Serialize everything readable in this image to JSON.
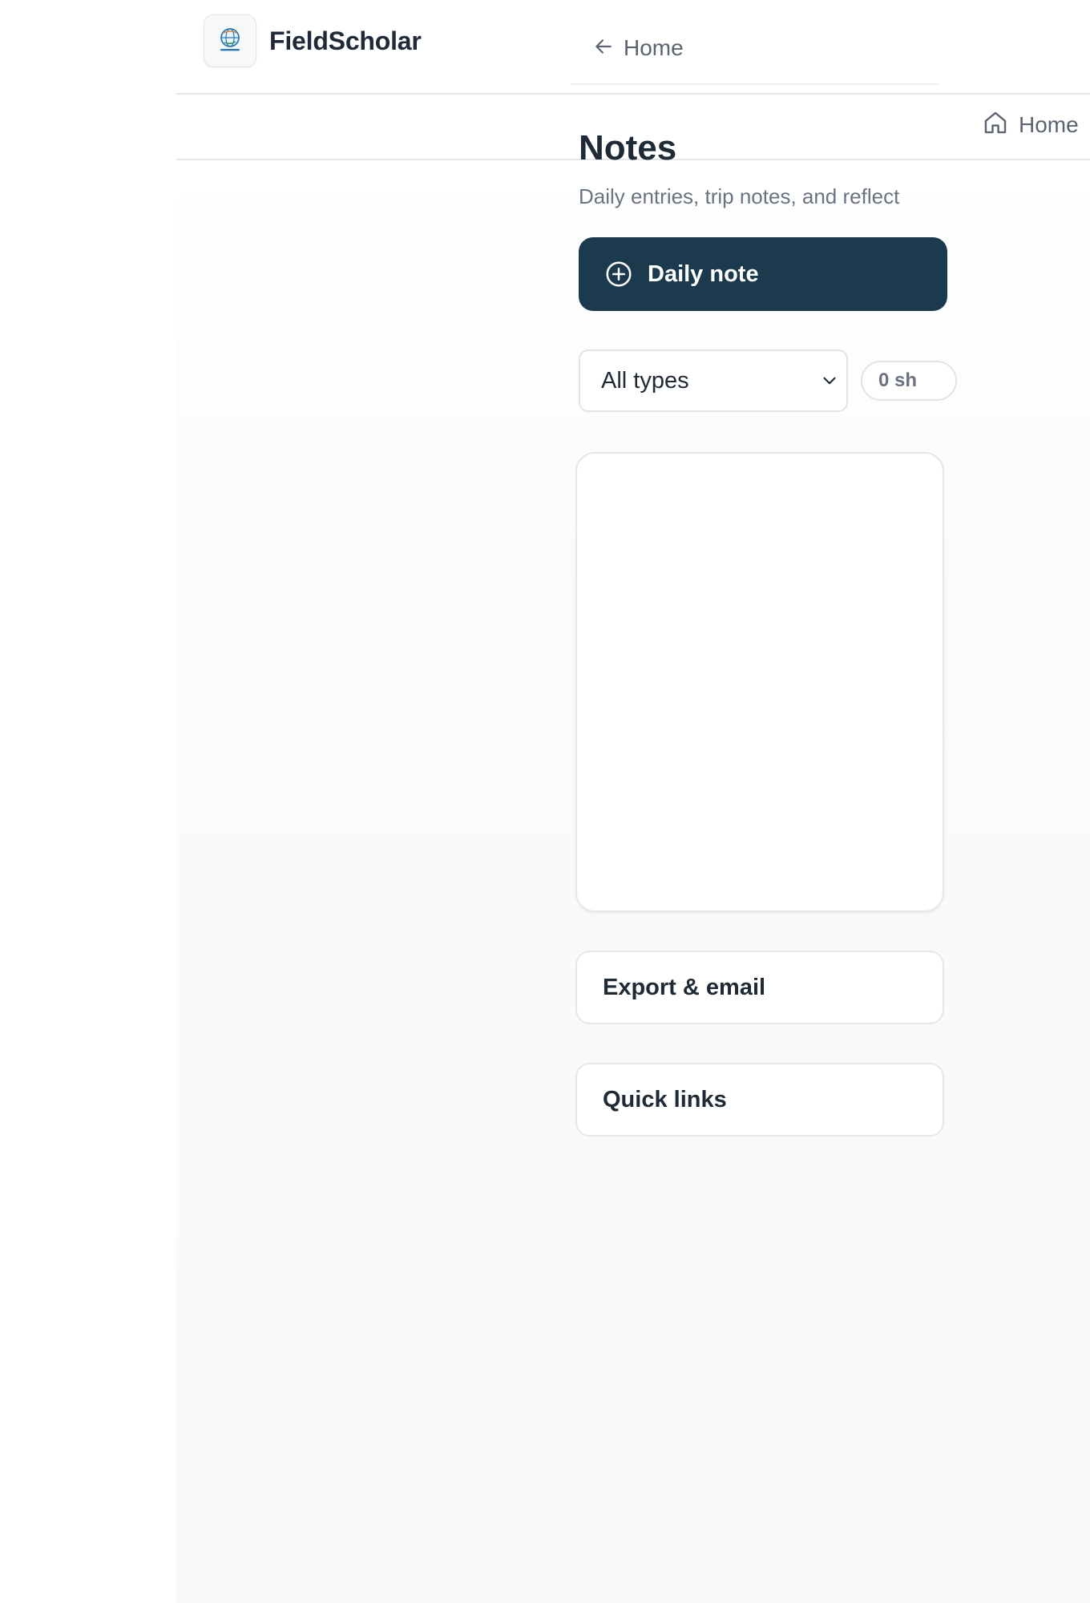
{
  "header": {
    "brand_name": "FieldScholar",
    "logo_icon": "globe-logo-icon"
  },
  "nav": {
    "home_label": "Home",
    "home_icon": "house-icon"
  },
  "breadcrumb": {
    "back_label": "Home",
    "back_icon": "arrow-left-icon"
  },
  "page": {
    "title": "Notes",
    "subtitle": "Daily entries, trip notes, and reflect"
  },
  "actions": {
    "daily_note_label": "Daily note",
    "daily_note_icon": "plus-circle-icon"
  },
  "filters": {
    "type_select_value": "All types",
    "count_pill": "0 sh"
  },
  "sections": {
    "export_label": "Export & email",
    "quick_links_label": "Quick links"
  },
  "colors": {
    "primary": "#1c3a4d",
    "text": "#1f2a37",
    "muted": "#6b7280",
    "border": "#e5e7eb"
  }
}
